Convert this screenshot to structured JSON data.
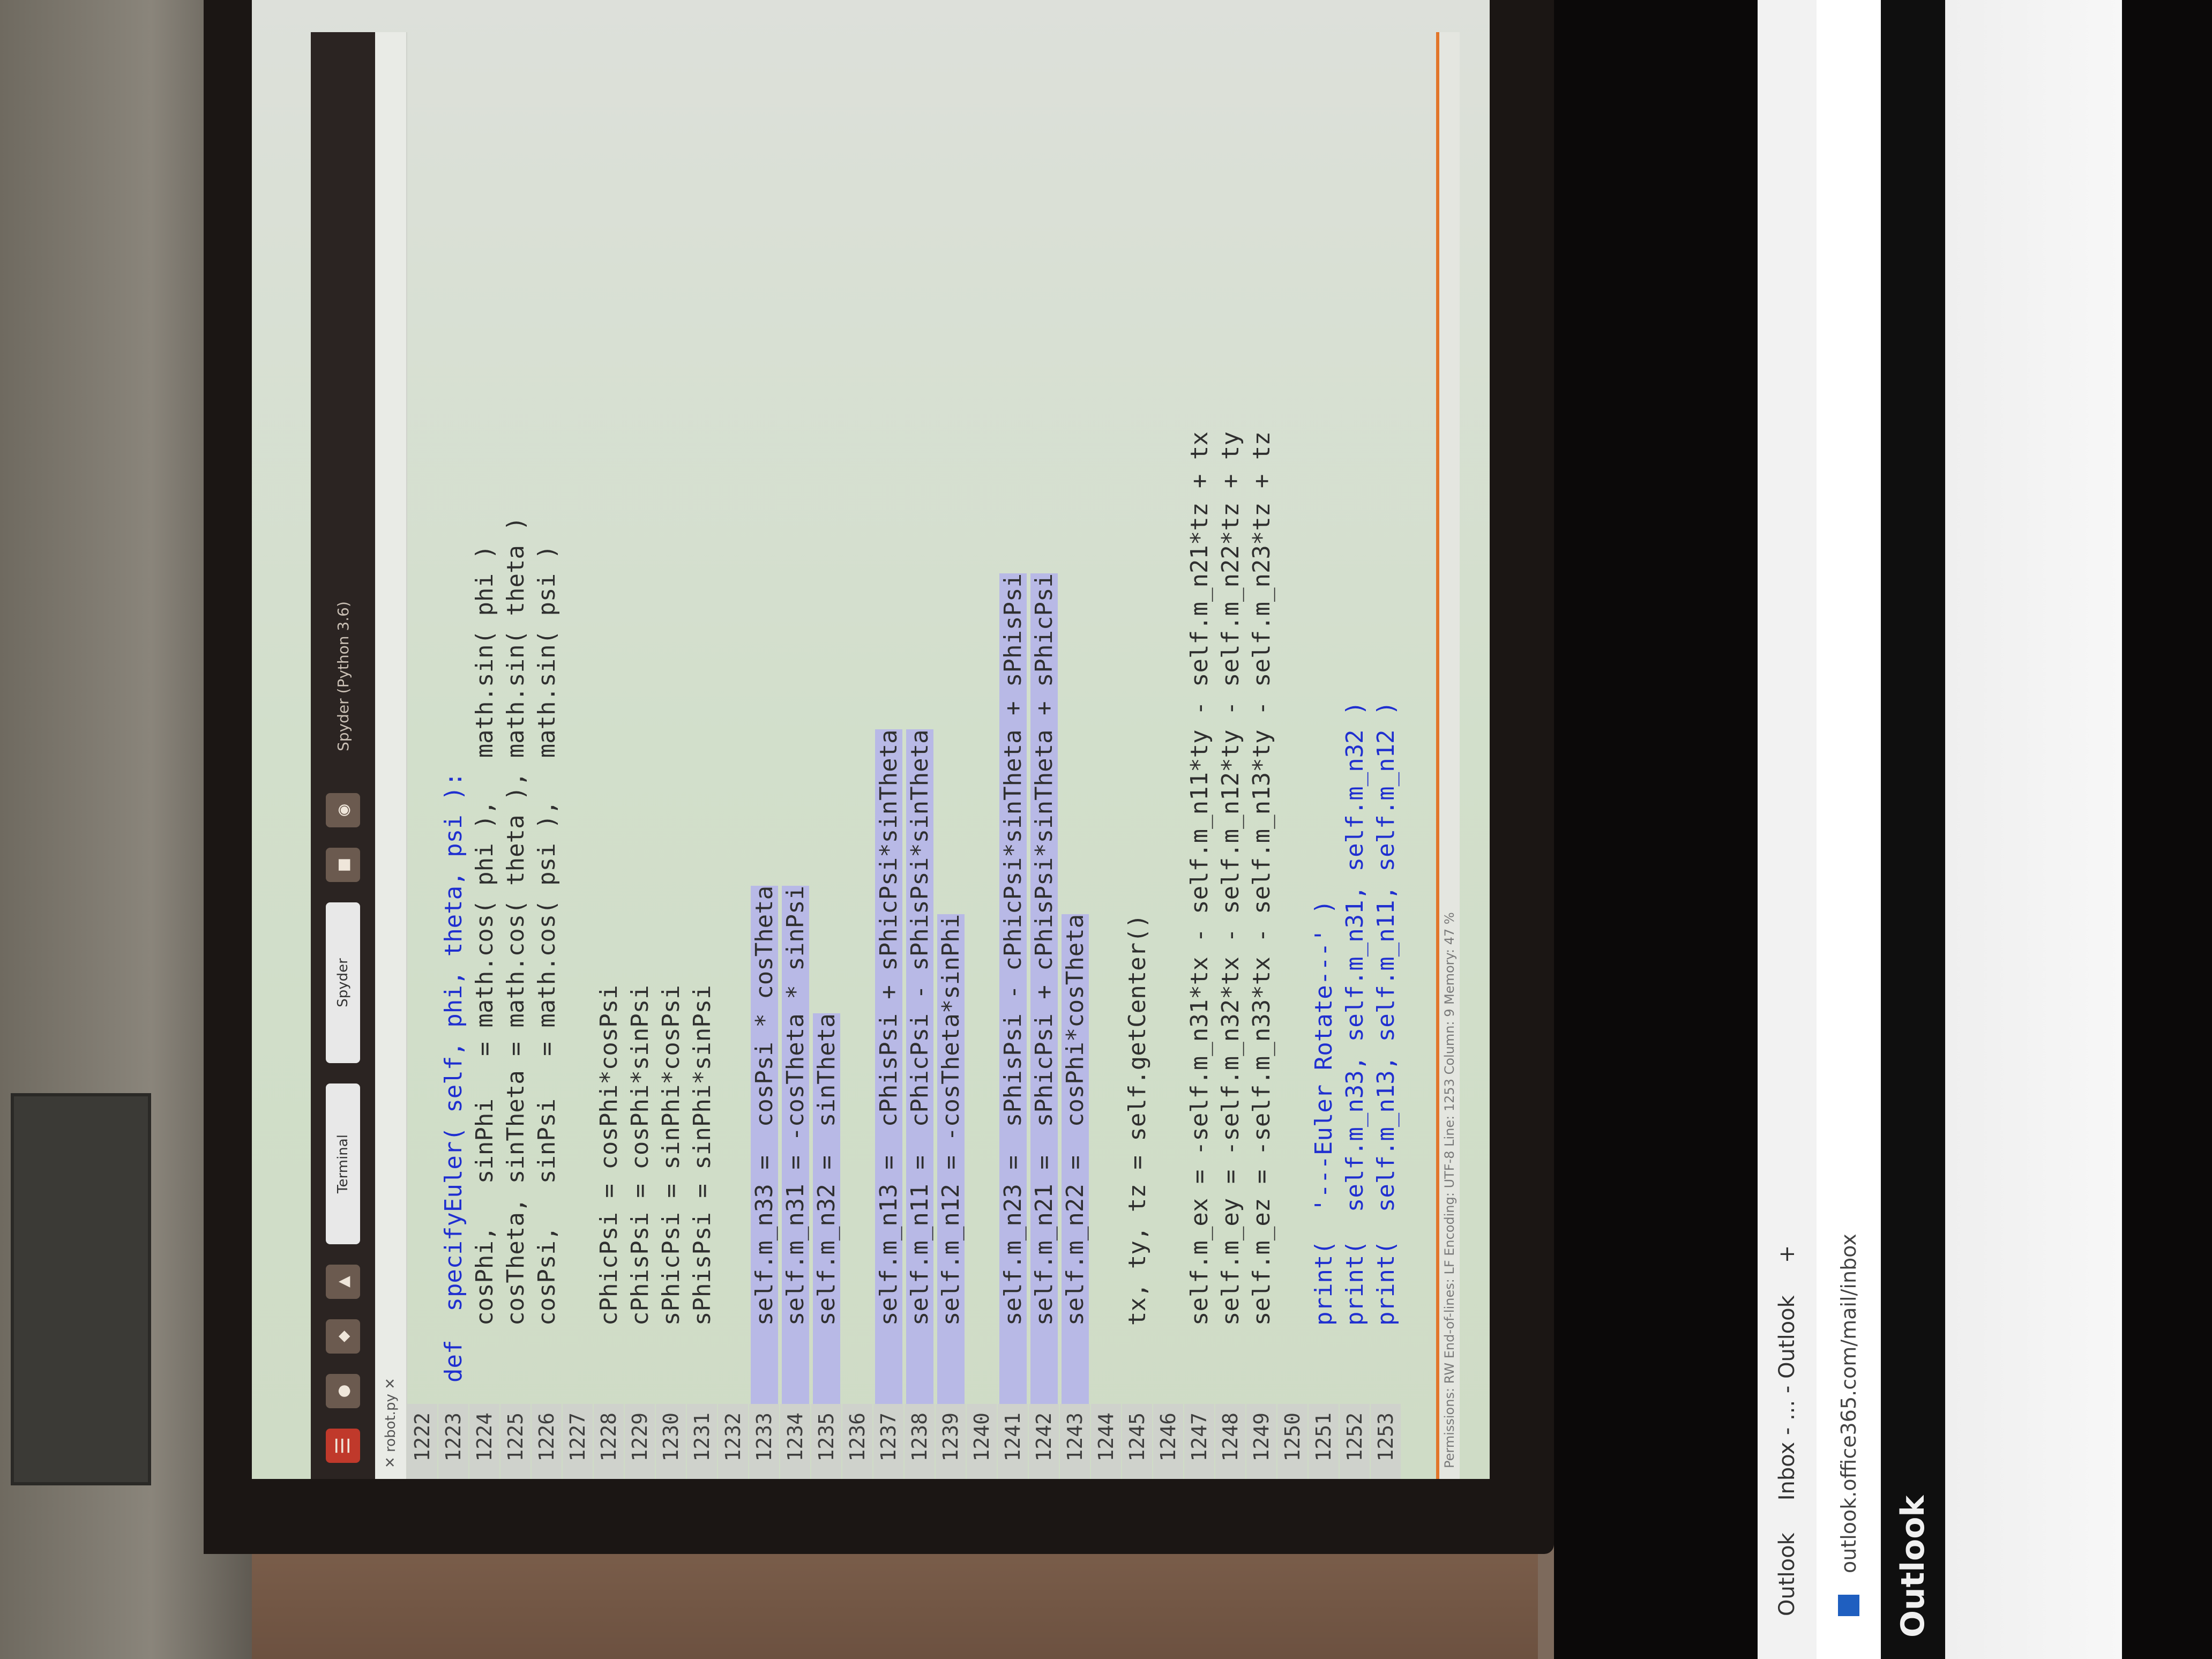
{
  "taskbar": {
    "icons": [
      "☰",
      "●",
      "◆",
      "▲",
      "■",
      "◉"
    ],
    "window_labels": [
      "Terminal",
      "Spyder"
    ],
    "title": "Spyder (Python 3.6)"
  },
  "editor": {
    "tab_label": "✕ robot.py ✕",
    "lines": [
      {
        "n": "1222",
        "t": "",
        "cls": ""
      },
      {
        "n": "1223",
        "t": "def  specifyEuler( self, phi, theta, psi ):",
        "cls": "kw"
      },
      {
        "n": "1224",
        "t": "    cosPhi,   sinPhi   = math.cos( phi ),   math.sin( phi )",
        "cls": ""
      },
      {
        "n": "1225",
        "t": "    cosTheta, sinTheta = math.cos( theta ), math.sin( theta )",
        "cls": ""
      },
      {
        "n": "1226",
        "t": "    cosPsi,   sinPsi   = math.cos( psi ),   math.sin( psi )",
        "cls": ""
      },
      {
        "n": "1227",
        "t": "",
        "cls": ""
      },
      {
        "n": "1228",
        "t": "    cPhicPsi = cosPhi*cosPsi",
        "cls": ""
      },
      {
        "n": "1229",
        "t": "    cPhisPsi = cosPhi*sinPsi",
        "cls": ""
      },
      {
        "n": "1230",
        "t": "    sPhicPsi = sinPhi*cosPsi",
        "cls": ""
      },
      {
        "n": "1231",
        "t": "    sPhisPsi = sinPhi*sinPsi",
        "cls": ""
      },
      {
        "n": "1232",
        "t": "",
        "cls": ""
      },
      {
        "n": "1233",
        "t": "    self.m_n33 =  cosPsi * cosTheta",
        "cls": "sel"
      },
      {
        "n": "1234",
        "t": "    self.m_n31 = -cosTheta * sinPsi",
        "cls": "sel"
      },
      {
        "n": "1235",
        "t": "    self.m_n32 =  sinTheta",
        "cls": "sel"
      },
      {
        "n": "1236",
        "t": "",
        "cls": ""
      },
      {
        "n": "1237",
        "t": "    self.m_n13 =  cPhisPsi + sPhicPsi*sinTheta",
        "cls": "sel"
      },
      {
        "n": "1238",
        "t": "    self.m_n11 =  cPhicPsi - sPhisPsi*sinTheta",
        "cls": "sel"
      },
      {
        "n": "1239",
        "t": "    self.m_n12 = -cosTheta*sinPhi",
        "cls": "sel"
      },
      {
        "n": "1240",
        "t": "",
        "cls": ""
      },
      {
        "n": "1241",
        "t": "    self.m_n23 =  sPhisPsi - cPhicPsi*sinTheta + sPhisPsi",
        "cls": "sel"
      },
      {
        "n": "1242",
        "t": "    self.m_n21 =  sPhicPsi + cPhisPsi*sinTheta + sPhicPsi",
        "cls": "sel"
      },
      {
        "n": "1243",
        "t": "    self.m_n22 =  cosPhi*cosTheta",
        "cls": "sel"
      },
      {
        "n": "1244",
        "t": "",
        "cls": ""
      },
      {
        "n": "1245",
        "t": "    tx, ty, tz = self.getCenter()",
        "cls": ""
      },
      {
        "n": "1246",
        "t": "",
        "cls": ""
      },
      {
        "n": "1247",
        "t": "    self.m_ex = -self.m_n31*tx - self.m_n11*ty - self.m_n21*tz + tx",
        "cls": ""
      },
      {
        "n": "1248",
        "t": "    self.m_ey = -self.m_n32*tx - self.m_n12*ty - self.m_n22*tz + ty",
        "cls": ""
      },
      {
        "n": "1249",
        "t": "    self.m_ez = -self.m_n33*tx - self.m_n13*ty - self.m_n23*tz + tz",
        "cls": ""
      },
      {
        "n": "1250",
        "t": "",
        "cls": ""
      },
      {
        "n": "1251",
        "t": "    print(  '---Euler Rotate---' )",
        "cls": "kw"
      },
      {
        "n": "1252",
        "t": "    print(  self.m_n33, self.m_n31, self.m_n32 )",
        "cls": "kw"
      },
      {
        "n": "1253",
        "t": "    print(  self.m_n13, self.m_n11, self.m_n12 )",
        "cls": "kw"
      }
    ]
  },
  "status": {
    "text": "Permissions: RW   End-of-lines: LF   Encoding: UTF-8   Line: 1253   Column: 9   Memory: 47 %"
  },
  "browser": {
    "tabs": [
      "Outlook",
      "Inbox - ... - Outlook",
      "+"
    ],
    "url": "outlook.office365.com/mail/inbox",
    "app_name": "Outlook"
  },
  "colors": {
    "keyword": "#1f2fd0",
    "selection": "#b8b9e6",
    "statusbar_accent": "#e2762a"
  }
}
